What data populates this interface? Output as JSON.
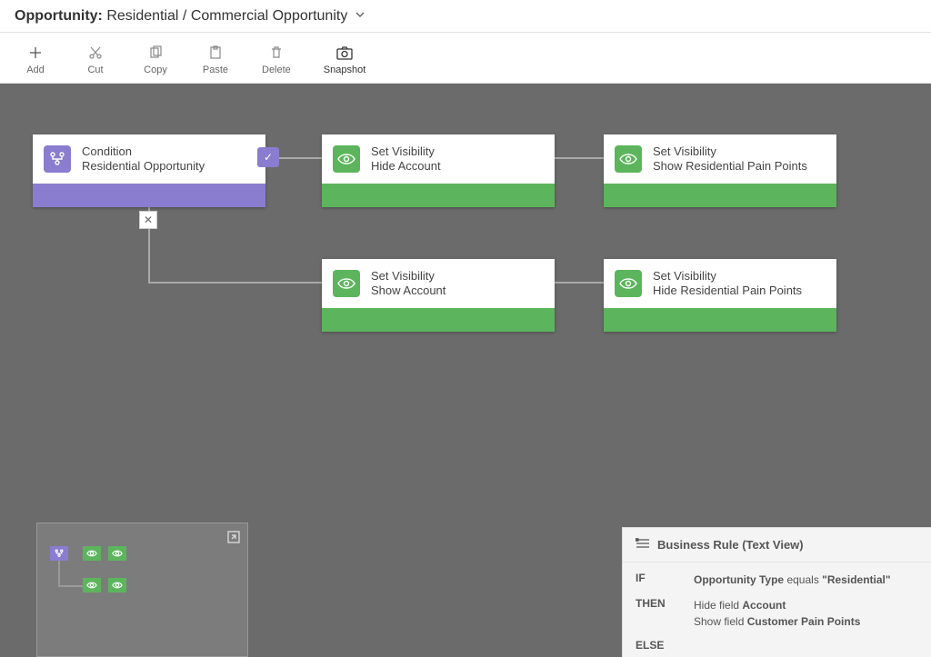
{
  "header": {
    "prefix": "Opportunity:",
    "title": "Residential / Commercial Opportunity"
  },
  "toolbar": {
    "add": "Add",
    "cut": "Cut",
    "copy": "Copy",
    "paste": "Paste",
    "delete": "Delete",
    "snapshot": "Snapshot"
  },
  "nodes": {
    "condition": {
      "title": "Condition",
      "subtitle": "Residential Opportunity"
    },
    "visHideAccount": {
      "title": "Set Visibility",
      "subtitle": "Hide Account"
    },
    "visShowResPain": {
      "title": "Set Visibility",
      "subtitle": "Show Residential Pain Points"
    },
    "visShowAccount": {
      "title": "Set Visibility",
      "subtitle": "Show Account"
    },
    "visHideResPain": {
      "title": "Set Visibility",
      "subtitle": "Hide Residential Pain Points"
    }
  },
  "textView": {
    "header": "Business Rule (Text View)",
    "ifLabel": "IF",
    "thenLabel": "THEN",
    "elseLabel": "ELSE",
    "ifLine_pre": "Opportunity Type ",
    "ifLine_mid": "equals ",
    "ifLine_val": "\"Residential\"",
    "then1_pre": "Hide field ",
    "then1_bold": "Account",
    "then2_pre": "Show field ",
    "then2_bold": "Customer Pain Points"
  },
  "badges": {
    "else": "✕",
    "check": "✓"
  }
}
